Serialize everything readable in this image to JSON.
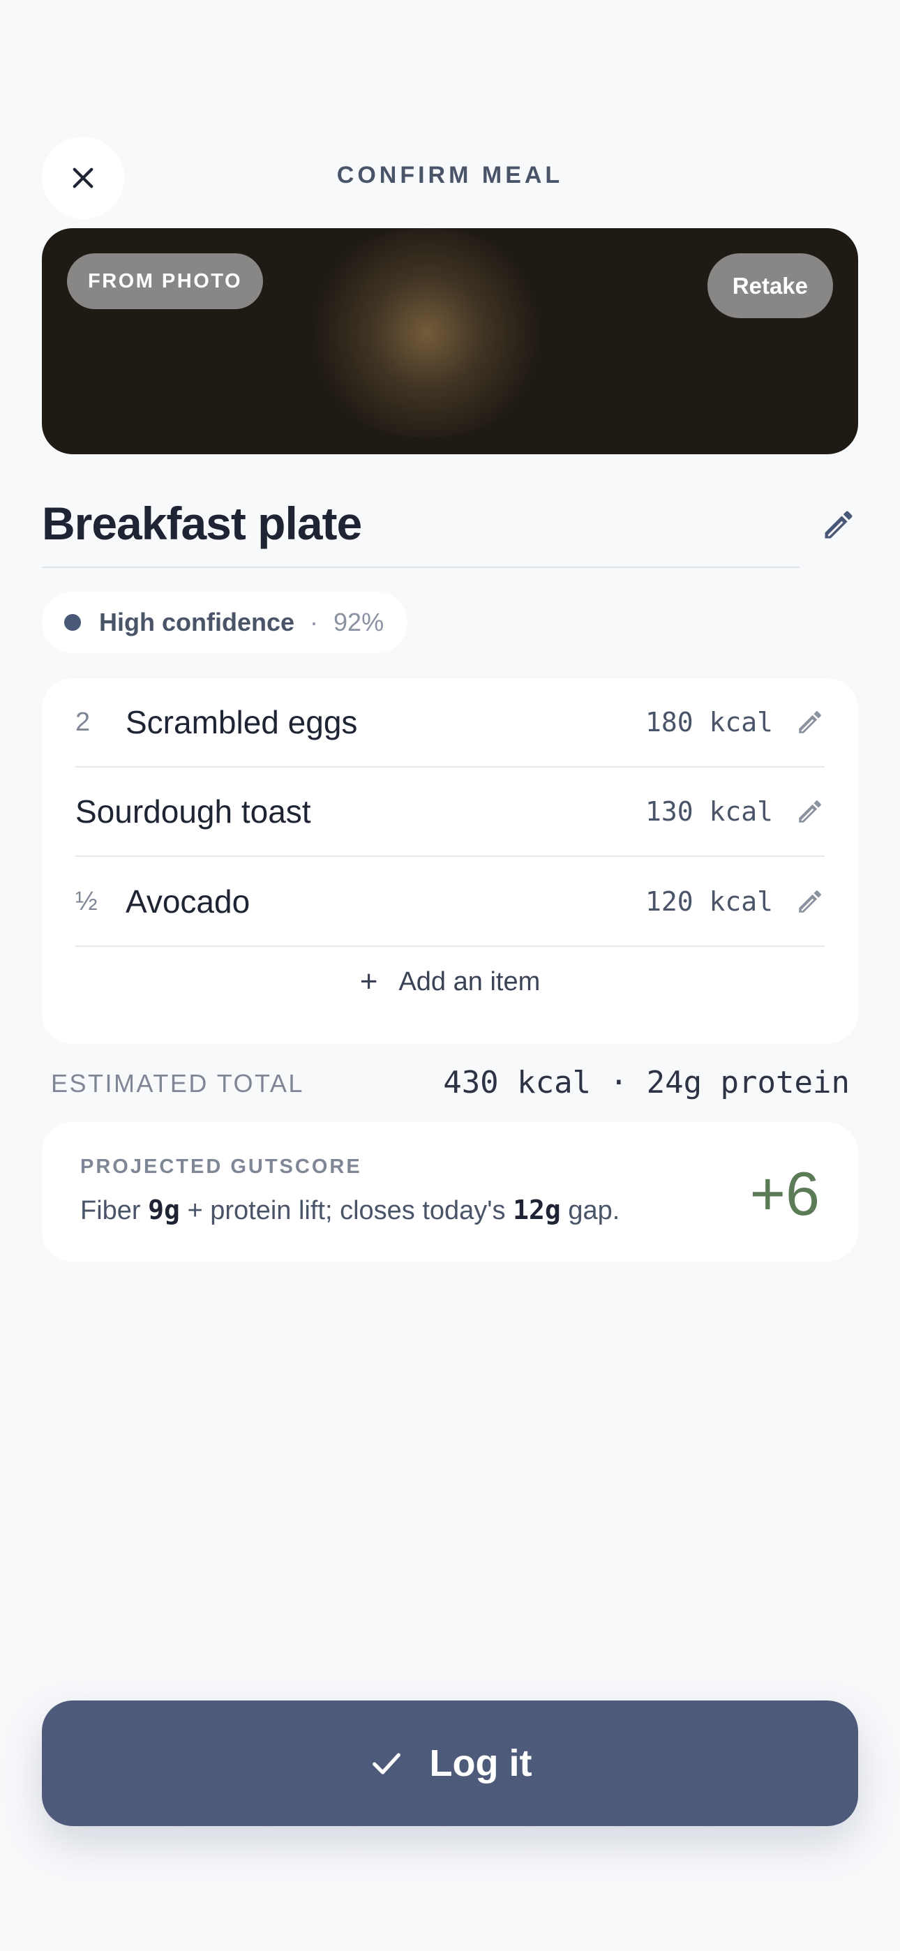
{
  "header": {
    "title": "CONFIRM MEAL",
    "close_icon": "close-icon"
  },
  "photo": {
    "source_label": "FROM PHOTO",
    "retake_label": "Retake"
  },
  "meal": {
    "name": "Breakfast plate"
  },
  "confidence": {
    "label": "High confidence",
    "separator": "·",
    "percent": "92%"
  },
  "items": [
    {
      "qty": "2",
      "name": "Scrambled eggs",
      "kcal": "180 kcal"
    },
    {
      "qty": "",
      "name": "Sourdough toast",
      "kcal": "130 kcal"
    },
    {
      "qty": "½",
      "name": "Avocado",
      "kcal": "120 kcal"
    }
  ],
  "add_item": {
    "plus": "+",
    "label": "Add an item"
  },
  "total": {
    "label": "ESTIMATED TOTAL",
    "value": "430 kcal · 24g protein"
  },
  "gutscore": {
    "label": "PROJECTED GUTSCORE",
    "desc_pre": "Fiber ",
    "fiber": "9g",
    "desc_mid": " + protein lift; closes today's ",
    "gap": "12g",
    "desc_post": " gap.",
    "score": "+6"
  },
  "log_button": {
    "label": "Log it"
  },
  "colors": {
    "accent": "#4d5a79",
    "positive": "#5b7a56",
    "background": "#f8f9fb"
  }
}
